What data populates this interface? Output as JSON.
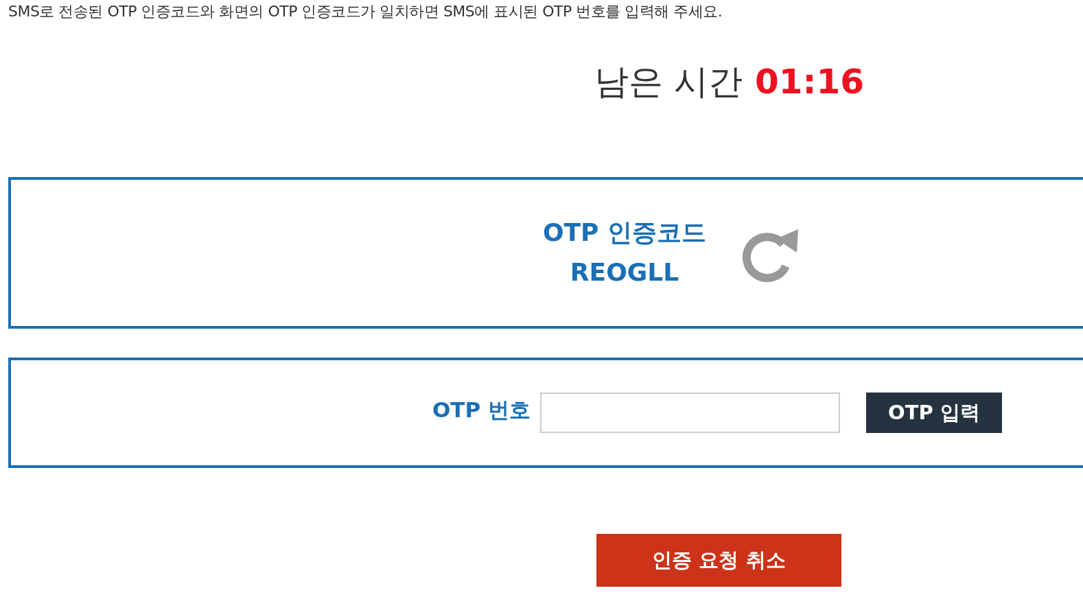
{
  "instruction": "SMS로 전송된 OTP 인증코드와 화면의 OTP 인증코드가 일치하면 SMS에 표시된 OTP 번호를 입력해 주세요.",
  "timer": {
    "label": "남은 시간",
    "value": "01:16"
  },
  "code_panel": {
    "title": "OTP 인증코드",
    "code": "REOGLL"
  },
  "otp_form": {
    "label": "OTP 번호",
    "submit_button": "OTP 입력"
  },
  "cancel_button": "인증 요청 취소"
}
